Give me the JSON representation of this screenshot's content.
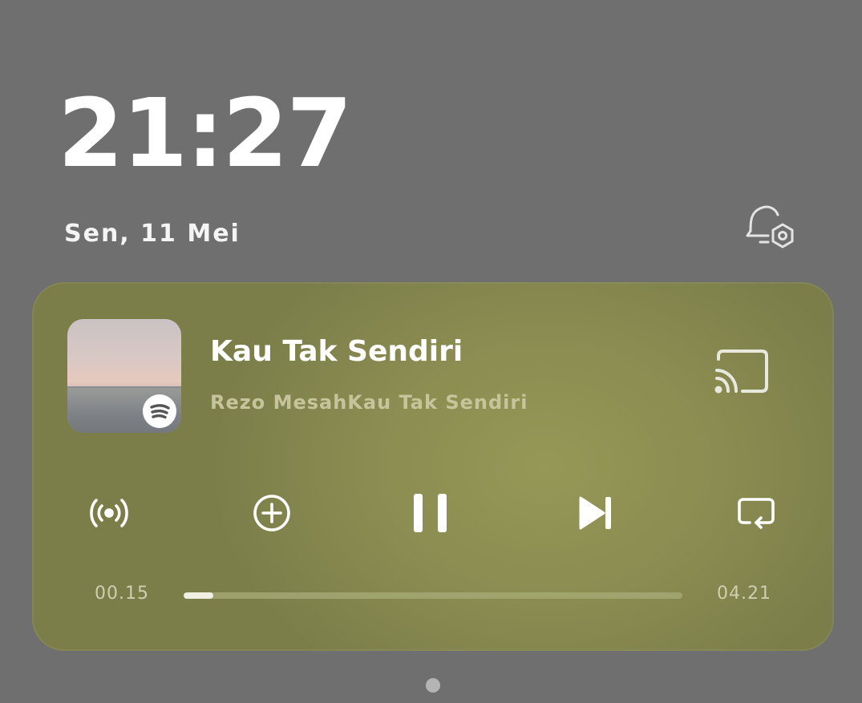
{
  "lockscreen": {
    "time": "21:27",
    "date": "Sen, 11 Mei"
  },
  "player": {
    "title": "Kau Tak Sendiri",
    "artist": "Rezo MesahKau Tak Sendiri",
    "elapsed": "00.15",
    "duration": "04.21",
    "progress_fraction": 0.06,
    "source_icon": "spotify-icon",
    "icons": {
      "cast": "cast-icon",
      "broadcast": "broadcast-icon",
      "add": "add-circle-icon",
      "pause": "pause-icon",
      "next": "skip-next-icon",
      "repeat": "repeat-icon"
    }
  },
  "colors": {
    "background": "#6f6f6f",
    "card": "#8c8e52",
    "artist_text": "#c5c49b",
    "progress_fill": "#efefe4"
  }
}
